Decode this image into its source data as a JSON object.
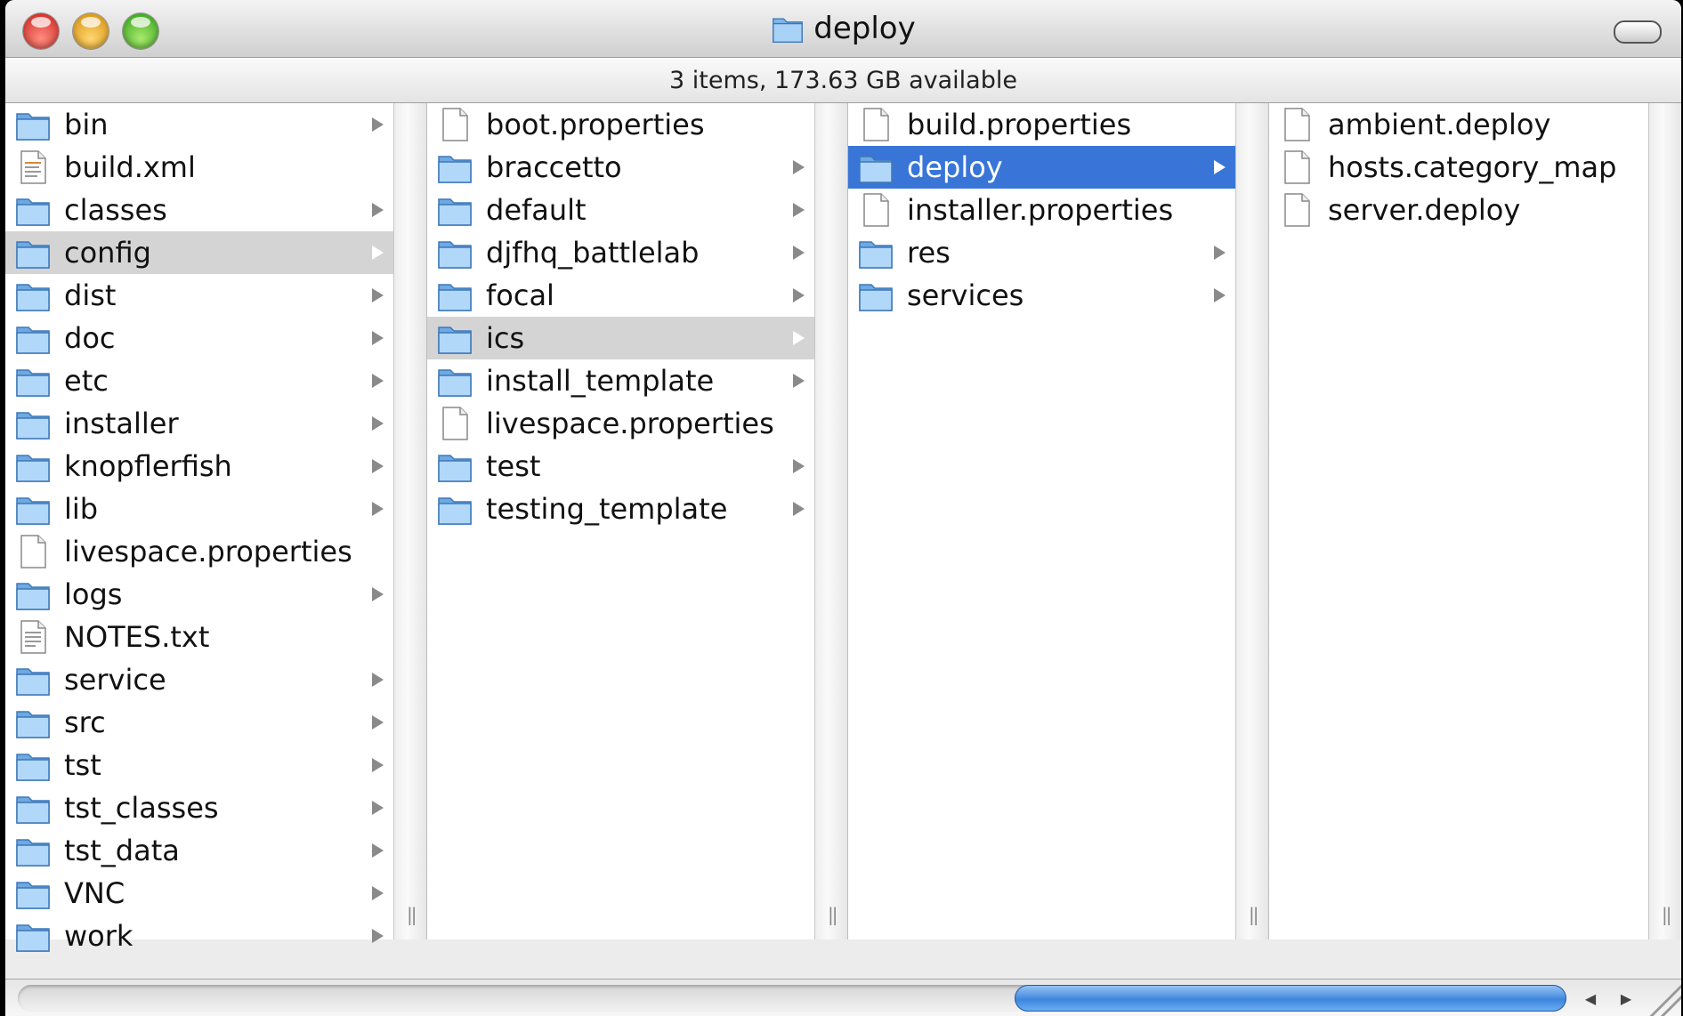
{
  "window": {
    "title": "deploy",
    "title_icon": "folder-icon",
    "status": "3 items, 173.63 GB available"
  },
  "columns": [
    {
      "name": "column-1",
      "items": [
        {
          "label": "bin",
          "type": "folder",
          "arrow": true
        },
        {
          "label": "build.xml",
          "type": "xml-file",
          "arrow": false
        },
        {
          "label": "classes",
          "type": "folder",
          "arrow": true
        },
        {
          "label": "config",
          "type": "folder",
          "arrow": true,
          "highlight": "gray"
        },
        {
          "label": "dist",
          "type": "folder",
          "arrow": true
        },
        {
          "label": "doc",
          "type": "folder",
          "arrow": true
        },
        {
          "label": "etc",
          "type": "folder",
          "arrow": true
        },
        {
          "label": "installer",
          "type": "folder",
          "arrow": true
        },
        {
          "label": "knopflerfish",
          "type": "folder",
          "arrow": true
        },
        {
          "label": "lib",
          "type": "folder",
          "arrow": true
        },
        {
          "label": "livespace.properties",
          "type": "file",
          "arrow": false
        },
        {
          "label": "logs",
          "type": "folder",
          "arrow": true
        },
        {
          "label": "NOTES.txt",
          "type": "text-file",
          "arrow": false
        },
        {
          "label": "service",
          "type": "folder",
          "arrow": true
        },
        {
          "label": "src",
          "type": "folder",
          "arrow": true
        },
        {
          "label": "tst",
          "type": "folder",
          "arrow": true
        },
        {
          "label": "tst_classes",
          "type": "folder",
          "arrow": true
        },
        {
          "label": "tst_data",
          "type": "folder",
          "arrow": true
        },
        {
          "label": "VNC",
          "type": "folder",
          "arrow": true
        },
        {
          "label": "work",
          "type": "folder",
          "arrow": true
        }
      ]
    },
    {
      "name": "column-2",
      "items": [
        {
          "label": "boot.properties",
          "type": "file",
          "arrow": false
        },
        {
          "label": "braccetto",
          "type": "folder",
          "arrow": true
        },
        {
          "label": "default",
          "type": "folder",
          "arrow": true
        },
        {
          "label": "djfhq_battlelab",
          "type": "folder",
          "arrow": true
        },
        {
          "label": "focal",
          "type": "folder",
          "arrow": true
        },
        {
          "label": "ics",
          "type": "folder",
          "arrow": true,
          "highlight": "gray"
        },
        {
          "label": "install_template",
          "type": "folder",
          "arrow": true
        },
        {
          "label": "livespace.properties",
          "type": "file",
          "arrow": false
        },
        {
          "label": "test",
          "type": "folder",
          "arrow": true
        },
        {
          "label": "testing_template",
          "type": "folder",
          "arrow": true
        }
      ]
    },
    {
      "name": "column-3",
      "items": [
        {
          "label": "build.properties",
          "type": "file",
          "arrow": false
        },
        {
          "label": "deploy",
          "type": "folder",
          "arrow": true,
          "highlight": "blue"
        },
        {
          "label": "installer.properties",
          "type": "file",
          "arrow": false
        },
        {
          "label": "res",
          "type": "folder",
          "arrow": true
        },
        {
          "label": "services",
          "type": "folder",
          "arrow": true
        }
      ]
    },
    {
      "name": "column-4",
      "items": [
        {
          "label": "ambient.deploy",
          "type": "file",
          "arrow": false
        },
        {
          "label": "hosts.category_map",
          "type": "file",
          "arrow": false
        },
        {
          "label": "server.deploy",
          "type": "file",
          "arrow": false
        }
      ]
    }
  ],
  "scrollbar": {
    "left_arrow": "◀",
    "right_arrow": "▶"
  },
  "colors": {
    "selection_blue": "#3875d7",
    "selection_gray": "#d4d4d4"
  }
}
